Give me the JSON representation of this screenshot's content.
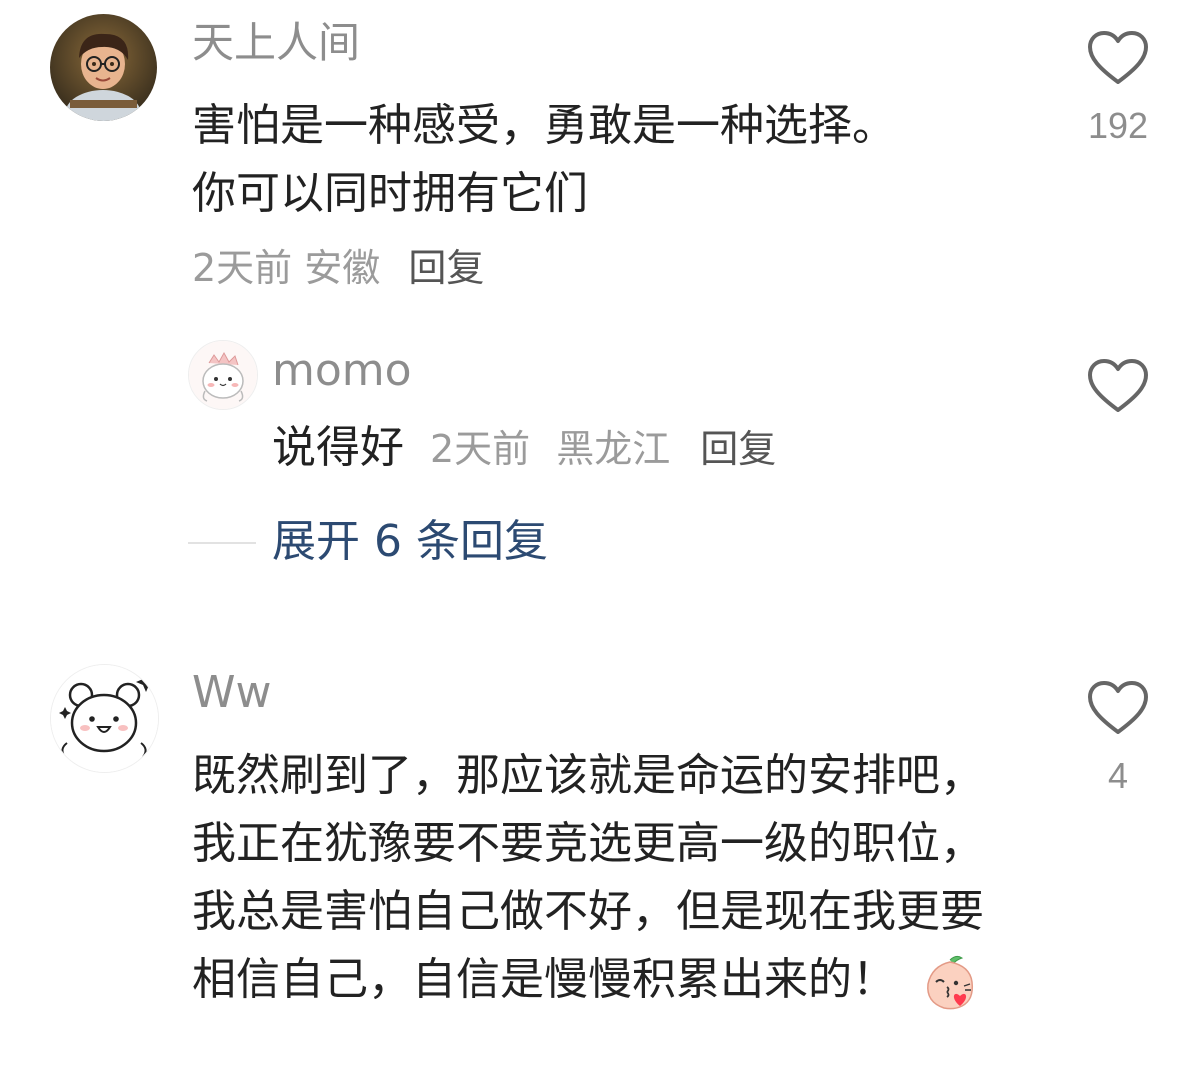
{
  "comments": [
    {
      "username": "天上人间",
      "text": "害怕是一种感受，勇敢是一种选择。 你可以同时拥有它们",
      "time": "2天前",
      "location": "安徽",
      "reply_label": "回复",
      "likes": "192",
      "avatar_icon": "boy-with-glasses-avatar"
    },
    {
      "username": "Ww",
      "text": "既然刷到了，那应该就是命运的安排吧，我正在犹豫要不要竞选更高一级的职位，我总是害怕自己做不好，但是现在我更要相信自己，自信是慢慢积累出来的！",
      "likes": "4",
      "avatar_icon": "cartoon-bear-avatar",
      "emoji_icon": "blowing-kiss-peach-emoji"
    }
  ],
  "reply": {
    "username": "momo",
    "text": "说得好",
    "time": "2天前",
    "location": "黑龙江",
    "reply_label": "回复",
    "avatar_icon": "cartoon-dino-avatar"
  },
  "expand": {
    "label": "展开 6 条回复"
  },
  "colors": {
    "username": "#8d8d8d",
    "content": "#222222",
    "meta": "#9b9b9b",
    "expand_link": "#2c4a72"
  }
}
